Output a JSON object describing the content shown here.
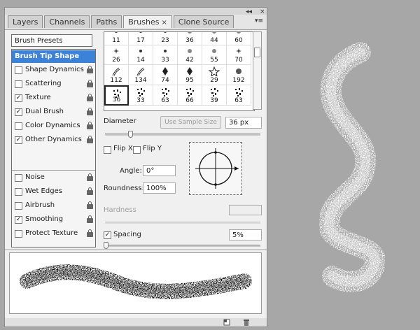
{
  "panel": {
    "collapse_glyph": "◂◂",
    "close_glyph": "×",
    "menu_glyph": "▾≡",
    "tabs": [
      {
        "label": "Layers"
      },
      {
        "label": "Channels"
      },
      {
        "label": "Paths"
      },
      {
        "label": "Brushes",
        "close": "×"
      },
      {
        "label": "Clone Source"
      }
    ],
    "active_tab": "Brushes"
  },
  "options": {
    "presets_label": "Brush Presets",
    "tip_shape_label": "Brush Tip Shape",
    "items": [
      {
        "label": "Shape Dynamics",
        "checked": false,
        "check": ""
      },
      {
        "label": "Scattering",
        "checked": false,
        "check": ""
      },
      {
        "label": "Texture",
        "checked": true,
        "check": "✓"
      },
      {
        "label": "Dual Brush",
        "checked": true,
        "check": "✓"
      },
      {
        "label": "Color Dynamics",
        "checked": false,
        "check": ""
      },
      {
        "label": "Other Dynamics",
        "checked": true,
        "check": "✓"
      },
      {
        "label": "Noise",
        "checked": false,
        "check": ""
      },
      {
        "label": "Wet Edges",
        "checked": false,
        "check": ""
      },
      {
        "label": "Airbrush",
        "checked": false,
        "check": ""
      },
      {
        "label": "Smoothing",
        "checked": true,
        "check": "✓"
      },
      {
        "label": "Protect Texture",
        "checked": false,
        "check": ""
      }
    ]
  },
  "brush_grid": {
    "rows": [
      [
        "11",
        "17",
        "23",
        "36",
        "44",
        "60"
      ],
      [
        "26",
        "14",
        "33",
        "42",
        "55",
        "70"
      ],
      [
        "112",
        "134",
        "74",
        "95",
        "29",
        "192"
      ],
      [
        "36",
        "33",
        "63",
        "66",
        "39",
        "63"
      ]
    ],
    "selected": [
      3,
      0
    ]
  },
  "tip": {
    "diameter_label": "Diameter",
    "sample_button": "Use Sample Size",
    "diameter_value": "36 px",
    "flip_x_label": "Flip X",
    "flip_y_label": "Flip Y",
    "angle_label": "Angle:",
    "angle_value": "0°",
    "roundness_label": "Roundness:",
    "roundness_value": "100%",
    "hardness_label": "Hardness",
    "hardness_value": "",
    "spacing_label": "Spacing",
    "spacing_checked": true,
    "spacing_check": "✓",
    "spacing_value": "5%"
  },
  "colors": {
    "canvas_bg": "#a7a7a7",
    "panel_bg": "#f0f0f0",
    "selection_blue": "#3c82d9"
  }
}
